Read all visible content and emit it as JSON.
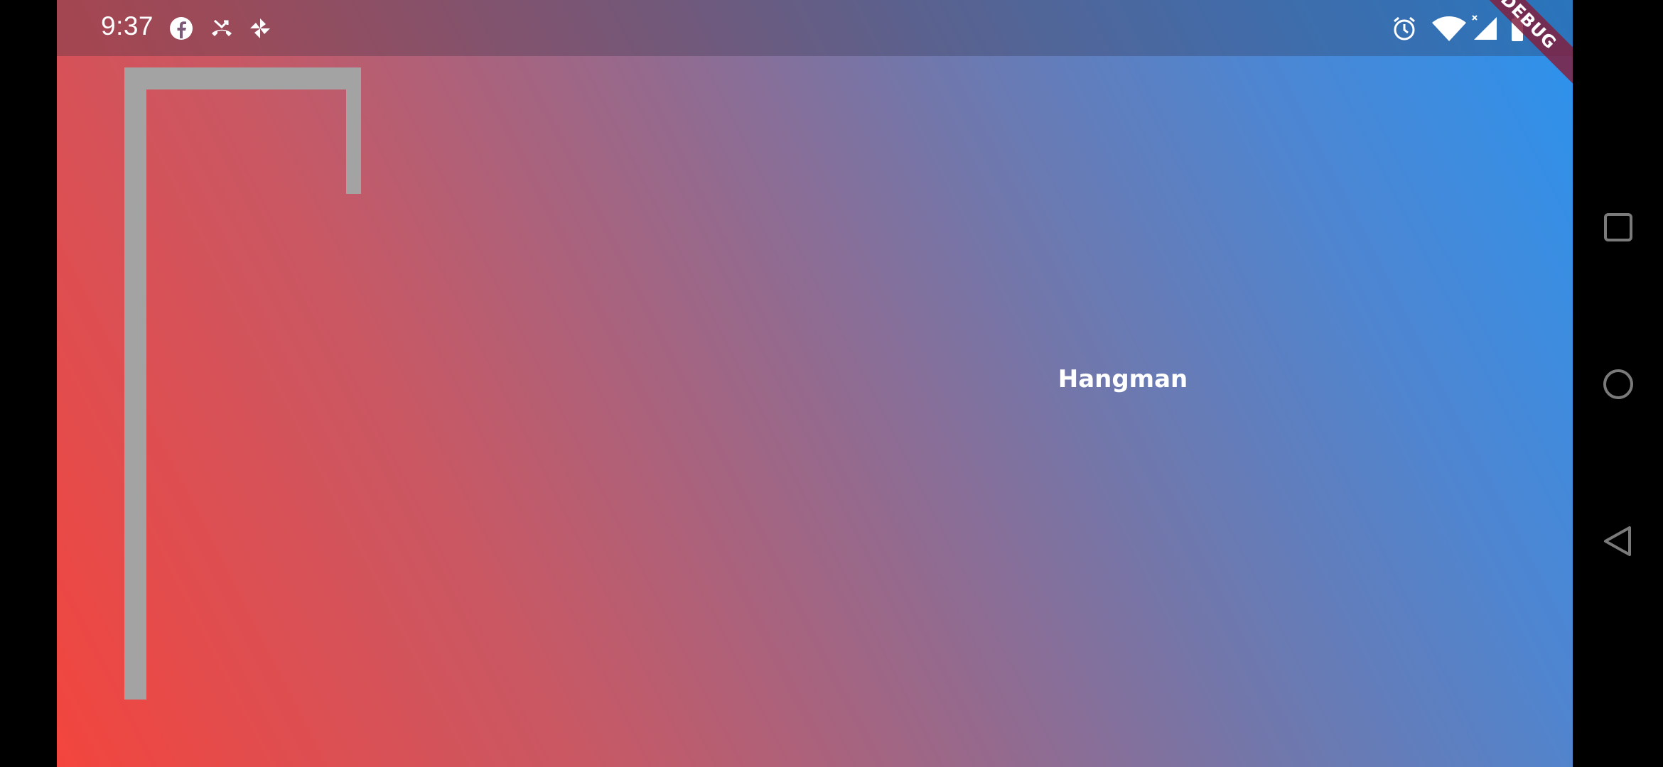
{
  "status_bar": {
    "time": "9:37",
    "left_icons": [
      "facebook-icon",
      "missed-call-icon",
      "pinwheel-icon"
    ],
    "right_icons": [
      "alarm-icon",
      "wifi-icon",
      "cell-signal-icon",
      "battery-icon"
    ]
  },
  "debug_banner": {
    "label": "DEBUG",
    "color": "#802040"
  },
  "app": {
    "title": "Hangman",
    "gradient": {
      "start": "#f3453e",
      "end": "#2b93ee"
    },
    "gallows_color": "#a3a3a3"
  },
  "nav_bar": {
    "buttons": [
      "recents-icon",
      "home-icon",
      "back-icon"
    ]
  }
}
